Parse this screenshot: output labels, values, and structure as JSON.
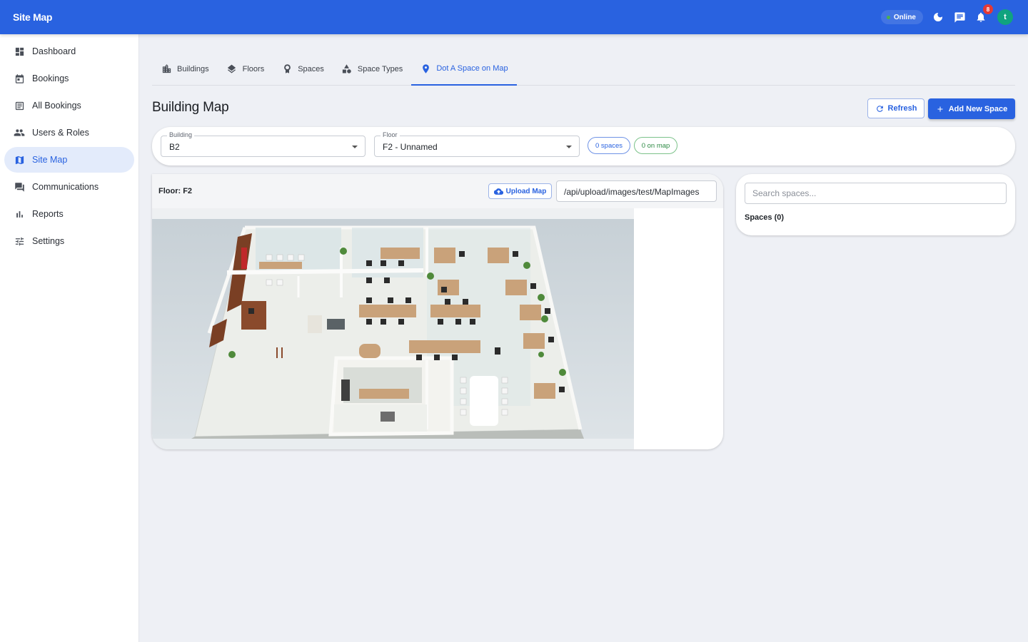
{
  "app": {
    "title": "Site Map"
  },
  "topbar": {
    "status": "Online",
    "notification_count": "8",
    "avatar_initial": "t"
  },
  "sidebar": {
    "items": [
      {
        "label": "Dashboard",
        "icon": "dashboard-icon"
      },
      {
        "label": "Bookings",
        "icon": "calendar-icon"
      },
      {
        "label": "All Bookings",
        "icon": "list-icon"
      },
      {
        "label": "Users & Roles",
        "icon": "people-icon"
      },
      {
        "label": "Site Map",
        "icon": "map-icon",
        "active": true
      },
      {
        "label": "Communications",
        "icon": "chat-icon"
      },
      {
        "label": "Reports",
        "icon": "bar-chart-icon"
      },
      {
        "label": "Settings",
        "icon": "sliders-icon"
      }
    ]
  },
  "tabs": [
    {
      "label": "Buildings",
      "icon": "building-icon"
    },
    {
      "label": "Floors",
      "icon": "layers-icon"
    },
    {
      "label": "Spaces",
      "icon": "badge-icon"
    },
    {
      "label": "Space Types",
      "icon": "shapes-icon"
    },
    {
      "label": "Dot A Space on Map",
      "icon": "pin-icon",
      "active": true
    }
  ],
  "header": {
    "title": "Building Map",
    "refresh_label": "Refresh",
    "add_label": "Add New Space"
  },
  "filters": {
    "building": {
      "label": "Building",
      "value": "B2"
    },
    "floor": {
      "label": "Floor",
      "value": "F2 - Unnamed"
    },
    "spaces_chip": "0 spaces",
    "on_map_chip": "0 on map"
  },
  "map": {
    "floor_label": "Floor: F2",
    "upload_label": "Upload Map",
    "path_value": "/api/upload/images/test/MapImages"
  },
  "spaces_panel": {
    "search_placeholder": "Search spaces...",
    "count_label": "Spaces (0)"
  },
  "colors": {
    "primary": "#2962e0",
    "online": "#4caf50",
    "badge": "#e53935",
    "avatar": "#10a37f"
  }
}
